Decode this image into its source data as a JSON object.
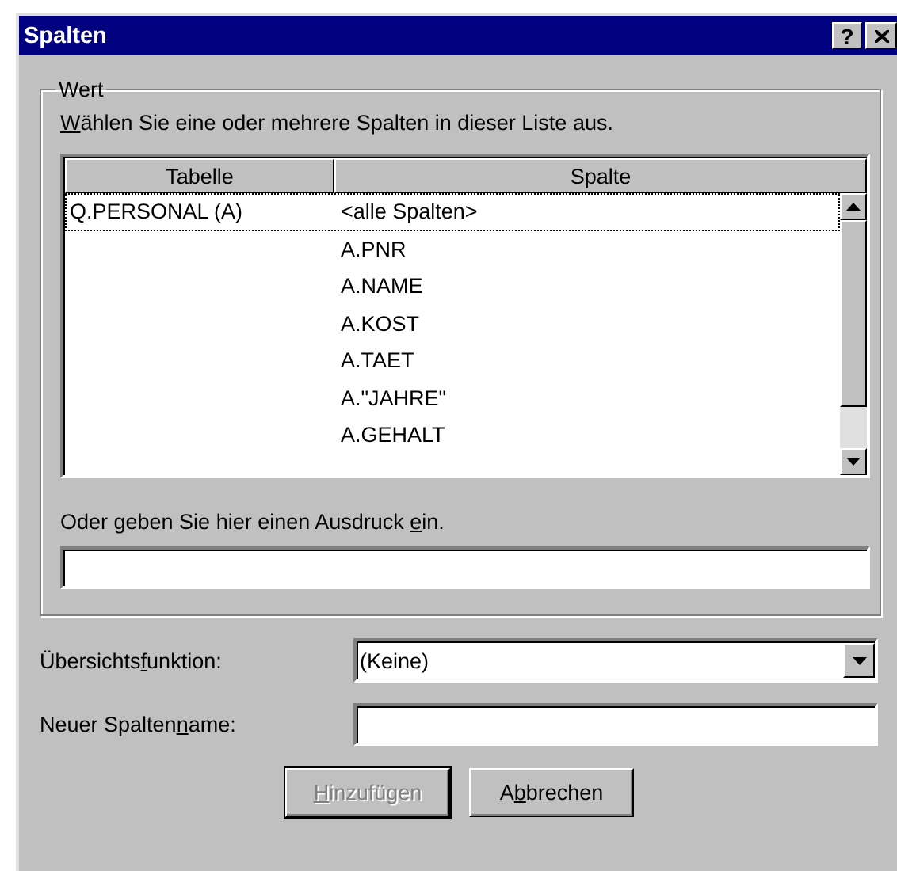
{
  "window": {
    "title": "Spalten",
    "help_button": "?"
  },
  "group": {
    "title": "Wert",
    "list_label": {
      "key": "W",
      "post": "ählen Sie eine oder mehrere Spalten in dieser Liste aus."
    },
    "columns": [
      "Tabelle",
      "Spalte"
    ],
    "rows": [
      {
        "table": "Q.PERSONAL (A)",
        "column": "<alle Spalten>",
        "focused": true
      },
      {
        "column": "A.PNR",
        "focused": false
      },
      {
        "column": "A.NAME",
        "focused": false
      },
      {
        "column": "A.KOST",
        "focused": false
      },
      {
        "column": "A.TAET",
        "focused": false
      },
      {
        "column": "A.\"JAHRE\"",
        "focused": false
      },
      {
        "column": "A.GEHALT",
        "focused": false
      }
    ],
    "expression_label": {
      "pre": "Oder geben Sie hier einen Ausdruck ",
      "key": "e",
      "post": "in."
    }
  },
  "summary": {
    "label": {
      "pre": "Übersichts",
      "key": "f",
      "post": "unktion:"
    },
    "value": "(Keine)"
  },
  "new_name": {
    "label": {
      "pre": "Neuer Spalten",
      "key": "n",
      "post": "ame:"
    }
  },
  "buttons": [
    {
      "label": {
        "key": "H",
        "post": "inzufügen"
      },
      "disabled": true,
      "default": true
    },
    {
      "label": {
        "pre": "A",
        "key": "b",
        "post": "brechen"
      },
      "disabled": false,
      "default": false
    }
  ]
}
